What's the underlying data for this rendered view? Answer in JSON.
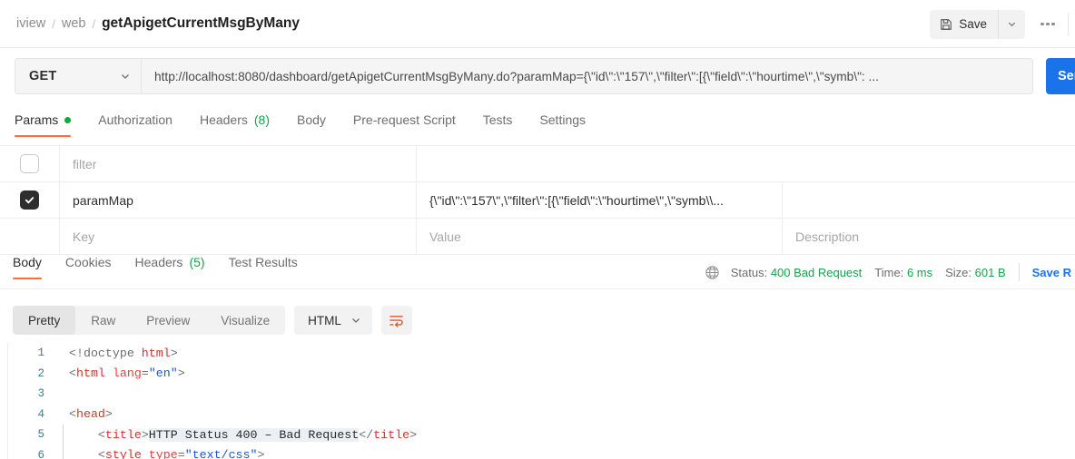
{
  "header": {
    "breadcrumb": [
      "iview",
      "web"
    ],
    "breadcrumb_current": "getApigetCurrentMsgByMany",
    "save_label": "Save",
    "save_icon": "floppy-disk-icon",
    "caret_icon": "chevron-down-icon",
    "more_icon": "ellipsis-icon"
  },
  "request": {
    "method": "GET",
    "method_caret_icon": "chevron-down-icon",
    "url": "http://localhost:8080/dashboard/getApigetCurrentMsgByMany.do?paramMap={\\\"id\\\":\\\"157\\\",\\\"filter\\\":[{\\\"field\\\":\\\"hourtime\\\",\\\"symb\\\": ...",
    "send_label": "Send",
    "send_color": "#1a73e8"
  },
  "request_tabs": [
    {
      "label": "Params",
      "badge_dot": true,
      "active": true
    },
    {
      "label": "Authorization",
      "active": false
    },
    {
      "label": "Headers",
      "count": "(8)",
      "active": false
    },
    {
      "label": "Body",
      "active": false
    },
    {
      "label": "Pre-request Script",
      "active": false
    },
    {
      "label": "Tests",
      "active": false
    },
    {
      "label": "Settings",
      "active": false
    }
  ],
  "params_table": {
    "placeholders": {
      "key": "Key",
      "value": "Value",
      "description": "Description"
    },
    "rows": [
      {
        "checked": false,
        "key": "filter",
        "value": "",
        "description": "",
        "key_muted": true
      },
      {
        "checked": true,
        "key": "paramMap",
        "value": "{\\\"id\\\":\\\"157\\\",\\\"filter\\\":[{\\\"field\\\":\\\"hourtime\\\",\\\"symb\\\\...",
        "description": "",
        "key_muted": false
      }
    ]
  },
  "response_tabs": [
    {
      "label": "Body",
      "active": true
    },
    {
      "label": "Cookies",
      "active": false
    },
    {
      "label": "Headers",
      "count": "(5)",
      "active": false
    },
    {
      "label": "Test Results",
      "active": false
    }
  ],
  "response_meta": {
    "globe_icon": "globe-icon",
    "status_label": "Status:",
    "status_value": "400 Bad Request",
    "time_label": "Time:",
    "time_value": "6 ms",
    "size_label": "Size:",
    "size_value": "601 B",
    "save_response_label": "Save R",
    "value_color": "#16a34a",
    "link_color": "#1a73e8"
  },
  "body_toolbar": {
    "views": [
      {
        "label": "Pretty",
        "active": true
      },
      {
        "label": "Raw",
        "active": false
      },
      {
        "label": "Preview",
        "active": false
      },
      {
        "label": "Visualize",
        "active": false
      }
    ],
    "format": "HTML",
    "format_caret_icon": "chevron-down-icon",
    "wrap_icon": "word-wrap-icon",
    "wrap_icon_color": "#e2542a"
  },
  "code_lines": [
    {
      "num": "1",
      "fold": false,
      "tokens": [
        {
          "t": "<!doctype ",
          "c": "t-punc"
        },
        {
          "t": "html",
          "c": "t-tag"
        },
        {
          "t": ">",
          "c": "t-punc"
        }
      ]
    },
    {
      "num": "2",
      "fold": false,
      "tokens": [
        {
          "t": "<",
          "c": "t-punc"
        },
        {
          "t": "html ",
          "c": "t-tag"
        },
        {
          "t": "lang",
          "c": "t-attr"
        },
        {
          "t": "=",
          "c": "t-punc"
        },
        {
          "t": "\"en\"",
          "c": "t-val"
        },
        {
          "t": ">",
          "c": "t-punc"
        }
      ]
    },
    {
      "num": "3",
      "fold": false,
      "tokens": []
    },
    {
      "num": "4",
      "fold": false,
      "tokens": [
        {
          "t": "<",
          "c": "t-punc"
        },
        {
          "t": "head",
          "c": "t-tag"
        },
        {
          "t": ">",
          "c": "t-punc"
        }
      ]
    },
    {
      "num": "5",
      "fold": true,
      "tokens": [
        {
          "t": "    <",
          "c": "t-punc"
        },
        {
          "t": "title",
          "c": "t-tag"
        },
        {
          "t": ">",
          "c": "t-punc"
        },
        {
          "t": "HTTP Status 400 – Bad Request",
          "c": "t-txt"
        },
        {
          "t": "</",
          "c": "t-punc"
        },
        {
          "t": "title",
          "c": "t-tag"
        },
        {
          "t": ">",
          "c": "t-punc"
        }
      ]
    },
    {
      "num": "6",
      "fold": true,
      "tokens": [
        {
          "t": "    <",
          "c": "t-punc"
        },
        {
          "t": "style ",
          "c": "t-tag"
        },
        {
          "t": "type",
          "c": "t-attr"
        },
        {
          "t": "=",
          "c": "t-punc"
        },
        {
          "t": "\"text/css\"",
          "c": "t-val"
        },
        {
          "t": ">",
          "c": "t-punc"
        }
      ]
    }
  ]
}
